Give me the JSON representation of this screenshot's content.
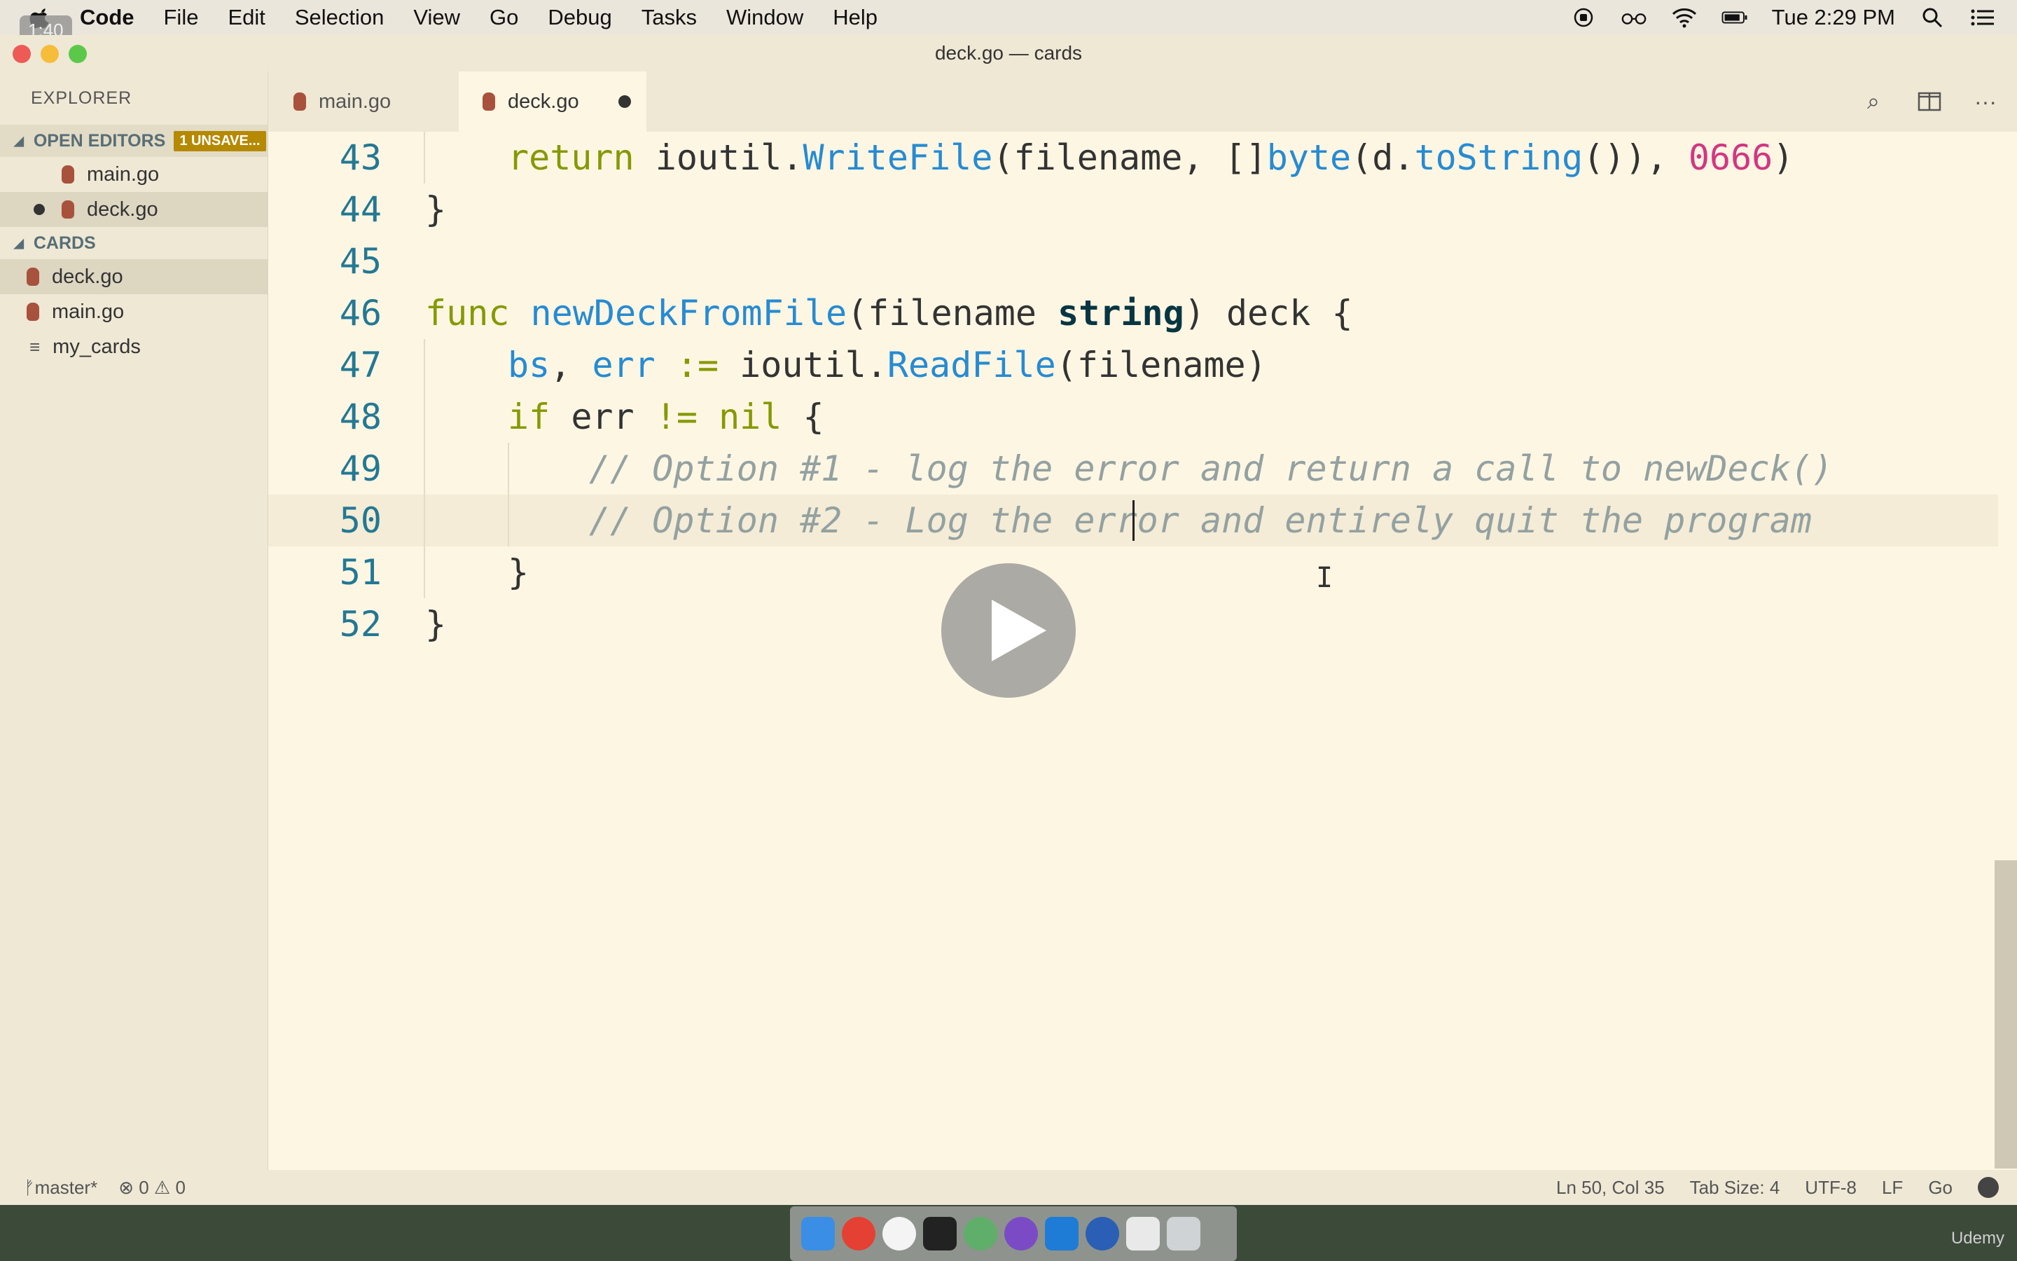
{
  "menubar": {
    "app": "Code",
    "items": [
      "File",
      "Edit",
      "Selection",
      "View",
      "Go",
      "Debug",
      "Tasks",
      "Window",
      "Help"
    ],
    "clock": "Tue 2:29 PM"
  },
  "video": {
    "timer": "1:40",
    "watermark": "Udemy"
  },
  "window": {
    "title": "deck.go — cards"
  },
  "sidebar": {
    "title": "EXPLORER",
    "open_editors": {
      "label": "OPEN EDITORS",
      "badge": "1 UNSAVE...",
      "items": [
        "main.go",
        "deck.go"
      ]
    },
    "project": {
      "label": "CARDS",
      "items": [
        "deck.go",
        "main.go",
        "my_cards"
      ]
    }
  },
  "tabs": [
    {
      "label": "main.go",
      "active": false
    },
    {
      "label": "deck.go",
      "active": true,
      "modified": true
    }
  ],
  "editor": {
    "lines": [
      {
        "n": "43",
        "text": "return ioutil.WriteFile(filename, []byte(d.toString()), 0666)"
      },
      {
        "n": "44",
        "text": "}"
      },
      {
        "n": "45",
        "text": ""
      },
      {
        "n": "46",
        "text": "func newDeckFromFile(filename string) deck {"
      },
      {
        "n": "47",
        "text": "bs, err := ioutil.ReadFile(filename)"
      },
      {
        "n": "48",
        "text": "if err != nil {"
      },
      {
        "n": "49",
        "text": "// Option #1 - log the error and return a call to newDeck()"
      },
      {
        "n": "50",
        "text": "// Option #2 - Log the error and entirely quit the program"
      },
      {
        "n": "51",
        "text": "}"
      },
      {
        "n": "52",
        "text": "}"
      }
    ],
    "current_line": "50"
  },
  "statusbar": {
    "branch": "master*",
    "errors": "0",
    "warnings": "0",
    "position": "Ln 50, Col 35",
    "tab_size": "Tab Size: 4",
    "encoding": "UTF-8",
    "eol": "LF",
    "language": "Go"
  },
  "colors": {
    "background": "#fdf6e3",
    "sidebar": "#eee8d5",
    "keyword": "#859900",
    "function": "#268bd2",
    "number": "#d33682",
    "comment": "#93a1a1",
    "line_number": "#237893"
  }
}
